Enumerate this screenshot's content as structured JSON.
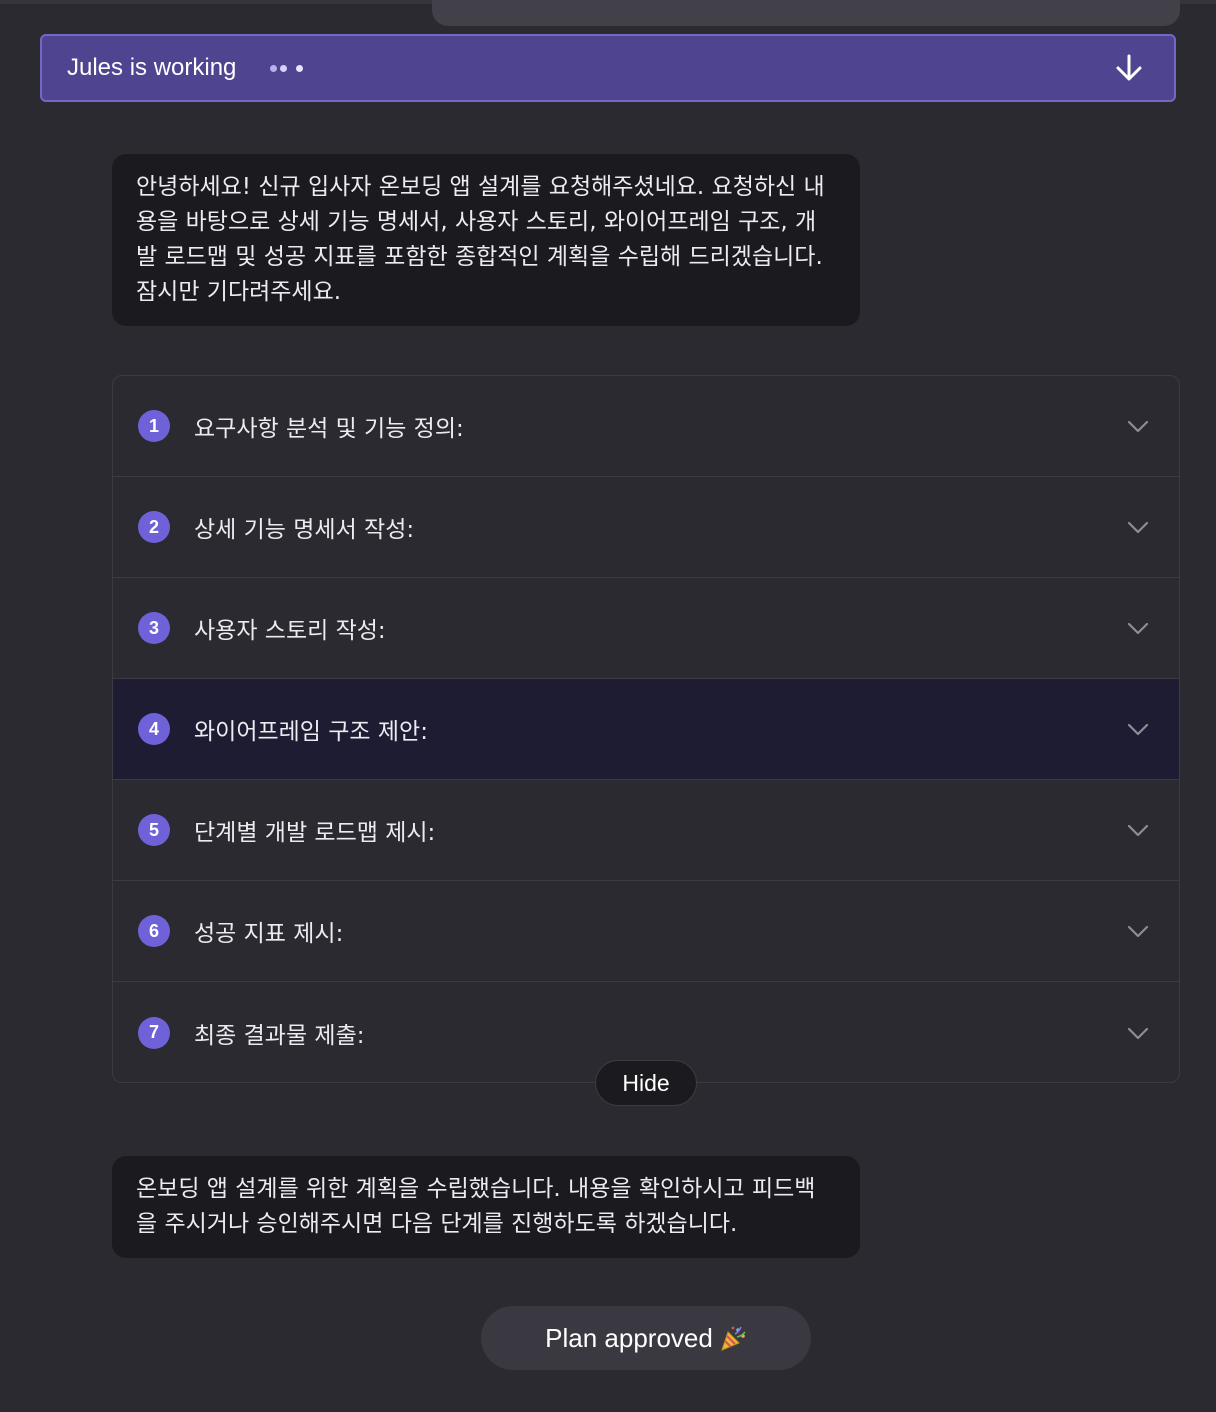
{
  "status": {
    "text": "Jules is working",
    "icon": "arrow-down-icon"
  },
  "messages": {
    "intro": "안녕하세요! 신규 입사자 온보딩 앱 설계를 요청해주셨네요. 요청하신 내용을 바탕으로 상세 기능 명세서, 사용자 스토리, 와이어프레임 구조, 개발 로드맵 및 성공 지표를 포함한 종합적인 계획을 수립해 드리겠습니다. 잠시만 기다려주세요.",
    "outro": "온보딩 앱 설계를 위한 계획을 수립했습니다. 내용을 확인하시고 피드백을 주시거나 승인해주시면 다음 단계를 진행하도록 하겠습니다."
  },
  "plan": {
    "items": [
      {
        "num": "1",
        "label": "요구사항 분석 및 기능 정의:"
      },
      {
        "num": "2",
        "label": "상세 기능 명세서 작성:"
      },
      {
        "num": "3",
        "label": "사용자 스토리 작성:"
      },
      {
        "num": "4",
        "label": "와이어프레임 구조 제안:"
      },
      {
        "num": "5",
        "label": "단계별 개발 로드맵 제시:"
      },
      {
        "num": "6",
        "label": "성공 지표 제시:"
      },
      {
        "num": "7",
        "label": "최종 결과물 제출:"
      }
    ],
    "hide_label": "Hide"
  },
  "approval": {
    "label": "Plan approved",
    "icon": "party-popper-icon"
  },
  "colors": {
    "background": "#2b2a30",
    "status_bar": "#4f4490",
    "accent": "#6f62d9",
    "bubble": "#1b1a1f",
    "active_row": "#1d1c33"
  }
}
